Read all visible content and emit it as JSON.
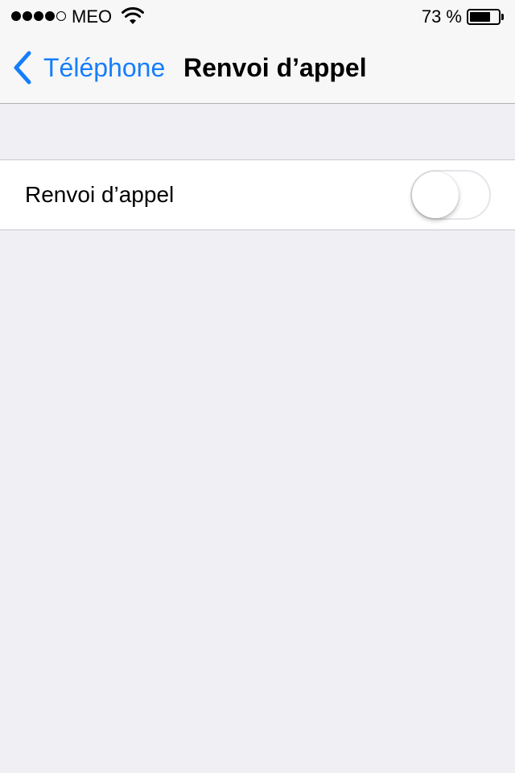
{
  "status_bar": {
    "signal_bars_filled": 4,
    "signal_bars_total": 5,
    "carrier": "MEO",
    "wifi_icon": "wifi-icon",
    "battery_percent_label": "73 %",
    "battery_level": 0.73
  },
  "nav": {
    "back_label": "Téléphone",
    "back_icon": "chevron-left-icon",
    "title": "Renvoi d’appel"
  },
  "settings": {
    "call_forwarding": {
      "label": "Renvoi d’appel",
      "enabled": false
    }
  },
  "colors": {
    "accent": "#157efb",
    "background": "#efeff4",
    "toggle_on": "#4cd964"
  }
}
